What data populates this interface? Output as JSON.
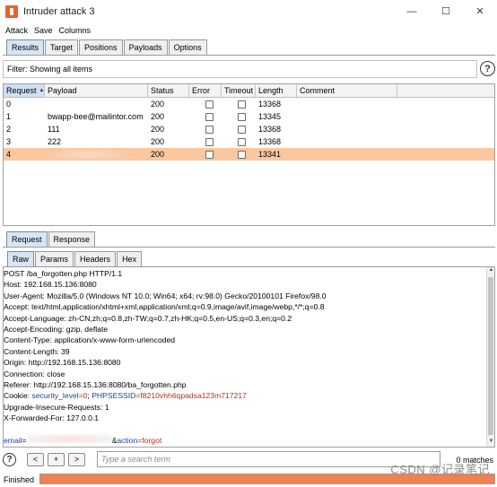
{
  "window": {
    "title": "Intruder attack 3",
    "controls": {
      "minimize": "—",
      "maximize": "☐",
      "close": "✕"
    }
  },
  "menubar": {
    "items": [
      "Attack",
      "Save",
      "Columns"
    ]
  },
  "top_tabs": [
    "Results",
    "Target",
    "Positions",
    "Payloads",
    "Options"
  ],
  "filter": {
    "text": "Filter: Showing all items",
    "help": "?"
  },
  "table": {
    "columns": [
      "Request",
      "Payload",
      "Status",
      "Error",
      "Timeout",
      "Length",
      "Comment"
    ],
    "sort_indicator": "▲",
    "rows": [
      {
        "request": "0",
        "payload": "",
        "status": "200",
        "length": "13368"
      },
      {
        "request": "1",
        "payload": "bwapp-bee@mailintor.com",
        "status": "200",
        "length": "13345"
      },
      {
        "request": "2",
        "payload": "111",
        "status": "200",
        "length": "13368"
      },
      {
        "request": "3",
        "payload": "222",
        "status": "200",
        "length": "13368"
      },
      {
        "request": "4",
        "payload": "",
        "status": "200",
        "length": "13341"
      }
    ]
  },
  "mid_tabs": [
    "Request",
    "Response"
  ],
  "sub_tabs": [
    "Raw",
    "Params",
    "Headers",
    "Hex"
  ],
  "raw": {
    "lines": [
      "POST /ba_forgotten.php HTTP/1.1",
      "Host: 192.168.15.136:8080",
      "User-Agent: Mozilla/5.0 (Windows NT 10.0; Win64; x64; rv:98.0) Gecko/20100101 Firefox/98.0",
      "Accept: text/html,application/xhtml+xml,application/xml;q=0.9,image/avif,image/webp,*/*;q=0.8",
      "Accept-Language: zh-CN,zh;q=0.8,zh-TW;q=0.7,zh-HK;q=0.5,en-US;q=0.3,en;q=0.2",
      "Accept-Encoding: gzip, deflate",
      "Content-Type: application/x-www-form-urlencoded",
      "Content-Length: 39",
      "Origin: http://192.168.15.136:8080",
      "Connection: close",
      "Referer: http://192.168.15.136:8080/ba_forgotten.php"
    ],
    "cookie": {
      "label": "Cookie: ",
      "k1": "security_level",
      "v1": "=0",
      "sep": "; ",
      "k2": "PHPSESSID",
      "v2": "=f8210vhh6qpadsa123m717217"
    },
    "lines2": [
      "Upgrade-Insecure-Requests: 1",
      "X-Forwarded-For: 127.0.0.1"
    ],
    "body": {
      "k1": "email",
      "eq": "=",
      "amp": "&",
      "k2": "action",
      "v2": "=forgot"
    }
  },
  "search": {
    "placeholder": "Type a search term",
    "matches": "0 matches",
    "help": "?",
    "prev": "<",
    "add": "+",
    "next": ">"
  },
  "status": {
    "text": "Finished",
    "progress": 1.0
  },
  "watermark": "CSDN @记录笔记",
  "colors": {
    "selected_row": "#fbc79f",
    "progress": "#f08150",
    "active_tab": "#d7e6f5"
  }
}
